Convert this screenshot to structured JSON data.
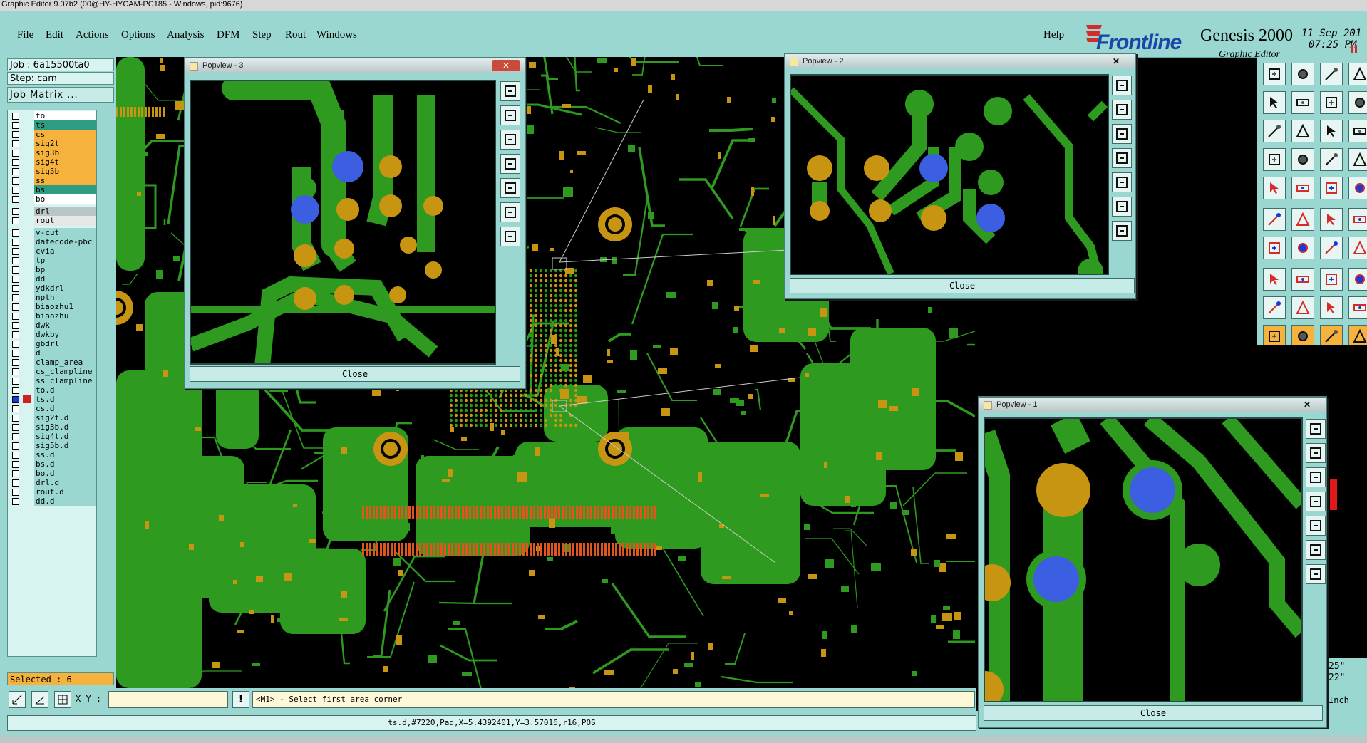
{
  "window": {
    "title": "Graphic Editor 9.07b2 (00@HY-HYCAM-PC185 - Windows, pid:9676)"
  },
  "menu": [
    "File",
    "Edit",
    "Actions",
    "Options",
    "Analysis",
    "DFM",
    "Step",
    "Rout",
    "Windows"
  ],
  "help": "Help",
  "brand": {
    "name": "Frontline",
    "product": "Genesis 2000",
    "subtitle": "Graphic Editor",
    "date": "11 Sep 201",
    "time": "07:25 PM"
  },
  "job": {
    "job_label": "Job : 6a15500ta0",
    "step_label": "Step: cam",
    "matrix_button": "Job Matrix ..."
  },
  "layers": [
    {
      "name": "to",
      "color": "#ffffff"
    },
    {
      "name": "ts",
      "color": "#2e9b83"
    },
    {
      "name": "cs",
      "color": "#f5b23c"
    },
    {
      "name": "sig2t",
      "color": "#f5b23c"
    },
    {
      "name": "sig3b",
      "color": "#f5b23c"
    },
    {
      "name": "sig4t",
      "color": "#f5b23c"
    },
    {
      "name": "sig5b",
      "color": "#f5b23c"
    },
    {
      "name": "ss",
      "color": "#f5b23c"
    },
    {
      "name": "bs",
      "color": "#2e9b83"
    },
    {
      "name": "bo",
      "color": "#ffffff"
    },
    {
      "name": "drl",
      "color": "#b8c7c5"
    },
    {
      "name": "rout",
      "color": "#e6e6e6"
    },
    {
      "name": "v-cut",
      "color": "#9ad7d1"
    },
    {
      "name": "datecode-pbc",
      "color": "#9ad7d1"
    },
    {
      "name": "cvia",
      "color": "#9ad7d1"
    },
    {
      "name": "tp",
      "color": "#9ad7d1"
    },
    {
      "name": "bp",
      "color": "#9ad7d1"
    },
    {
      "name": "dd",
      "color": "#9ad7d1"
    },
    {
      "name": "ydkdrl",
      "color": "#9ad7d1"
    },
    {
      "name": "npth",
      "color": "#9ad7d1"
    },
    {
      "name": "biaozhu1",
      "color": "#9ad7d1"
    },
    {
      "name": "biaozhu",
      "color": "#9ad7d1"
    },
    {
      "name": "dwk",
      "color": "#9ad7d1"
    },
    {
      "name": "dwkby",
      "color": "#9ad7d1"
    },
    {
      "name": "gbdrl",
      "color": "#9ad7d1"
    },
    {
      "name": "d",
      "color": "#9ad7d1"
    },
    {
      "name": "clamp_area",
      "color": "#9ad7d1"
    },
    {
      "name": "cs_clampline",
      "color": "#9ad7d1"
    },
    {
      "name": "ss_clampline",
      "color": "#9ad7d1"
    },
    {
      "name": "to.d",
      "color": "#9ad7d1"
    },
    {
      "name": "ts.d",
      "color": "#9ad7d1"
    },
    {
      "name": "cs.d",
      "color": "#9ad7d1"
    },
    {
      "name": "sig2t.d",
      "color": "#9ad7d1"
    },
    {
      "name": "sig3b.d",
      "color": "#9ad7d1"
    },
    {
      "name": "sig4t.d",
      "color": "#9ad7d1"
    },
    {
      "name": "sig5b.d",
      "color": "#9ad7d1"
    },
    {
      "name": "ss.d",
      "color": "#9ad7d1"
    },
    {
      "name": "bs.d",
      "color": "#9ad7d1"
    },
    {
      "name": "bo.d",
      "color": "#9ad7d1"
    },
    {
      "name": "drl.d",
      "color": "#9ad7d1"
    },
    {
      "name": "rout.d",
      "color": "#9ad7d1"
    },
    {
      "name": "dd.d",
      "color": "#9ad7d1"
    }
  ],
  "selected": "Selected : 6",
  "command": {
    "xy_label": "X Y :",
    "xy_value": "",
    "prompt": "<M1> - Select first area corner"
  },
  "status": "ts.d,#7220,Pad,X=5.4392401,Y=3.57016,r16,POS",
  "units": {
    "a": "25\"",
    "b": "22\"",
    "unit": "Inch"
  },
  "popviews": [
    {
      "title": "Popview - 3",
      "close": "Close"
    },
    {
      "title": "Popview - 2",
      "close": "Close"
    },
    {
      "title": "Popview - 1",
      "close": "Close"
    }
  ],
  "colors": {
    "board": "#2e9a1f",
    "copper": "#c79512",
    "via": "#3b5fe0",
    "panel": "#9ad7d1"
  }
}
